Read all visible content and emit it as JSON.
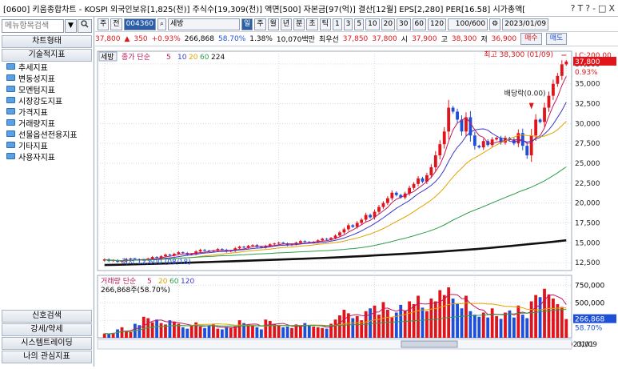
{
  "window": {
    "title": "[0600] 키움종합차트 - KOSPI 외국인보유[1,825(천)] 주식수[19,309(천)] 액면[500] 자본금[97(억)] 결산[12월] EPS[2,280] PER[16.58] 시가총액[",
    "btn_icons": [
      "?",
      "T",
      "?",
      "-",
      "□",
      "X"
    ]
  },
  "sidebar": {
    "search_placeholder": "메뉴항목검색",
    "tab_label": "차트형태",
    "section_label": "기술적지표",
    "items": [
      "추세지표",
      "변동성지표",
      "모멘텀지표",
      "시장강도지표",
      "가격지표",
      "거래량지표",
      "선물옵션전용지표",
      "기타지표",
      "사용자지표"
    ],
    "bottom": [
      "신호검색",
      "강세/약세",
      "시스템트레이딩",
      "나의 관심지표"
    ]
  },
  "toolbar": {
    "period": "주",
    "mode": "전",
    "code": "004360",
    "name": "세방",
    "buttons": [
      "일",
      "주",
      "월",
      "년",
      "분",
      "초",
      "틱",
      "1",
      "3",
      "5",
      "10",
      "20",
      "30",
      "60",
      "120"
    ],
    "count": "100/600",
    "date": "2023/01/09"
  },
  "quote": {
    "price": "37,800",
    "arrow": "▲",
    "change": "350",
    "pct": "+0.93%",
    "volume": "266,868",
    "ratio": "58.70%",
    "turnover": "1.38%",
    "prev_label": "10,070백만",
    "high_label": "최우선",
    "ask": "37,850",
    "bid": "37,800",
    "open_label": "시",
    "open": "37,900",
    "high_lbl": "고",
    "high": "38,300",
    "low_lbl": "저",
    "low": "36,900",
    "buy": "매수",
    "sell": "매도"
  },
  "price_panel": {
    "legend_name": "세방",
    "legend_ma": "종가 단순",
    "ma_periods": [
      "5",
      "10",
      "20",
      "60",
      "224"
    ],
    "lc": "LC:200.00",
    "last": "37,800",
    "last_pct": "0.93%",
    "high_note": "최고 38,300 (01/09)",
    "low_note": "최저 12,600 (08/18)",
    "dividend_note": "배당락(0.00)",
    "yticks": [
      "37,500",
      "35,000",
      "32,500",
      "30,000",
      "27,500",
      "25,000",
      "22,500",
      "20,000",
      "17,500",
      "15,000",
      "12,500"
    ]
  },
  "volume_panel": {
    "legend": "거래량 단순",
    "ma_periods": [
      "5",
      "20",
      "60",
      "120"
    ],
    "value_note": "266,868주(58.70%)",
    "yticks": [
      "750,000",
      "500,000",
      "250,000"
    ],
    "last": "266,868",
    "last_pct": "58.70%"
  },
  "xaxis": {
    "labels": [
      "2022/08",
      "09",
      "10",
      "11",
      "12",
      "2023/01"
    ],
    "right_label": "01/09"
  },
  "colors": {
    "up": "#e0151b",
    "down": "#1e4fd8",
    "ma5": "#c2185b",
    "ma10": "#3a3ac8",
    "ma20": "#e0a400",
    "ma60": "#2e9e49",
    "ma224": "#111111"
  },
  "chart_data": {
    "type": "candlestick",
    "price_range": [
      11500,
      38500
    ],
    "close": [
      12900,
      12700,
      12800,
      12600,
      12700,
      12900,
      13000,
      12900,
      12800,
      12850,
      13000,
      13200,
      13100,
      13300,
      13500,
      13400,
      13600,
      13800,
      13700,
      13500,
      13600,
      13900,
      14100,
      14000,
      13900,
      14000,
      14200,
      14100,
      13900,
      14000,
      14300,
      14500,
      14400,
      14600,
      14700,
      14500,
      14400,
      14600,
      14800,
      14900,
      15000,
      14900,
      14700,
      14800,
      15000,
      15200,
      15100,
      15000,
      15100,
      15300,
      15500,
      15400,
      15600,
      15900,
      16300,
      16700,
      17200,
      17000,
      17500,
      17900,
      18500,
      18200,
      18900,
      19500,
      20000,
      20600,
      21300,
      21000,
      20700,
      21200,
      21900,
      22400,
      23100,
      22700,
      23500,
      24500,
      26000,
      27400,
      29000,
      32000,
      31500,
      30500,
      29000,
      30800,
      28500,
      27200,
      27000,
      27800,
      27300,
      28000,
      28200,
      27600,
      28200,
      28000,
      27500,
      28800,
      27200,
      26000,
      28500,
      30500,
      30200,
      32000,
      33500,
      35000,
      36000,
      37450,
      37800
    ],
    "volume": [
      60,
      55,
      70,
      120,
      150,
      90,
      80,
      200,
      180,
      300,
      280,
      220,
      260,
      210,
      190,
      250,
      230,
      200,
      150,
      130,
      180,
      220,
      160,
      140,
      170,
      190,
      130,
      120,
      150,
      140,
      160,
      250,
      210,
      190,
      170,
      150,
      120,
      260,
      240,
      200,
      180,
      150,
      160,
      140,
      190,
      170,
      210,
      180,
      160,
      150,
      140,
      130,
      200,
      260,
      320,
      400,
      350,
      280,
      310,
      250,
      380,
      420,
      460,
      330,
      510,
      400,
      290,
      360,
      470,
      390,
      520,
      480,
      600,
      430,
      380,
      560,
      520,
      680,
      610,
      720,
      560,
      490,
      420,
      600,
      380,
      330,
      300,
      360,
      290,
      420,
      310,
      270,
      360,
      390,
      290,
      460,
      330,
      280,
      520,
      610,
      580,
      700,
      620,
      560,
      480,
      440,
      267
    ],
    "ma224_close": [
      12200,
      12230,
      12260,
      12300,
      12340,
      12380,
      12420,
      12470,
      12520,
      12560,
      12610,
      12650,
      12700,
      12750,
      12800,
      12850,
      12900,
      12950,
      13000,
      13060,
      13120,
      13180,
      13250,
      13320,
      13400,
      13480,
      13560,
      13640,
      13720,
      13810,
      13900,
      14000,
      14100,
      14200,
      14320,
      14450,
      14580,
      14720,
      14860,
      15000,
      15150,
      15310
    ]
  }
}
